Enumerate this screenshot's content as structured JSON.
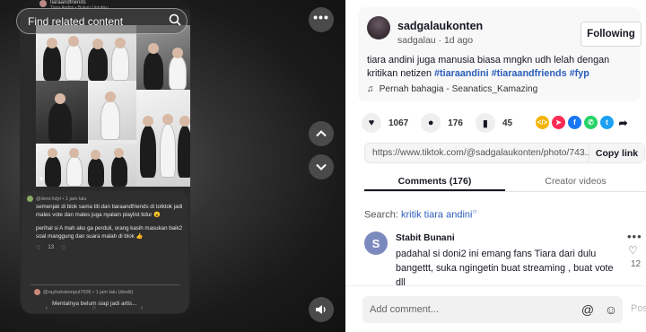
{
  "viewer": {
    "search_placeholder": "Find related content",
    "icons": {
      "search": "search-icon",
      "more": "more-icon",
      "up": "chevron-up-icon",
      "down": "chevron-down-icon",
      "volume": "volume-icon"
    },
    "phone": {
      "top_name": "tiaraandfriends",
      "top_sub": "Tiara Andini • Bukan Untukku",
      "comment_user": "@doni.hdyt • 1 jam lalu",
      "comment_text_1": "semenjak di blok sama titi dan tiaraandfriends di totktok jadi males vote dan males juga nyalain playlist tidur 😮",
      "comment_text_2": "perihal si A mah aku ga perduli, orang kasih masukan baik2 soal manggung dan suara malah di blok 👍",
      "comment_likes": "13",
      "reply_user": "@rayhakstompul7005 • 1 jam lalu (diedit)",
      "reply_text": "Mentalnya belum siap jadi artis...",
      "nav": "‹ ○ ›"
    }
  },
  "post": {
    "author_name": "sadgalaukonten",
    "author_handle": "sadgalau",
    "posted": "1d ago",
    "follow_label": "Following",
    "caption_text": "tiara andini juga manusia biasa mngkn udh lelah dengan kritikan netizen",
    "hashtags": [
      "#tiaraandini",
      "#tiaraandfriends",
      "#fyp"
    ],
    "music": "Pernah bahagia - Seanatics_Kamazing",
    "stats": {
      "likes": "1067",
      "comments": "176",
      "saves": "45"
    },
    "share_colors": [
      "#f4b400",
      "#fe2c55",
      "#1877f2",
      "#25d366",
      "#1da1f2"
    ],
    "link": "https://www.tiktok.com/@sadgalaukonten/photo/743...",
    "copy_label": "Copy link"
  },
  "tabs": [
    {
      "label": "Comments (176)",
      "active": true
    },
    {
      "label": "Creator videos",
      "active": false
    }
  ],
  "search": {
    "prefix": "Search:",
    "query": "kritik tiara andini"
  },
  "comment": {
    "avatar_letter": "S",
    "name": "Stabit Bunani",
    "text": "padahal si doni2 ini emang fans Tiara dari dulu bangettt, suka ngingetin buat streaming , buat vote dll",
    "likes": "12"
  },
  "footer": {
    "placeholder": "Add comment...",
    "post_label": "Post"
  }
}
